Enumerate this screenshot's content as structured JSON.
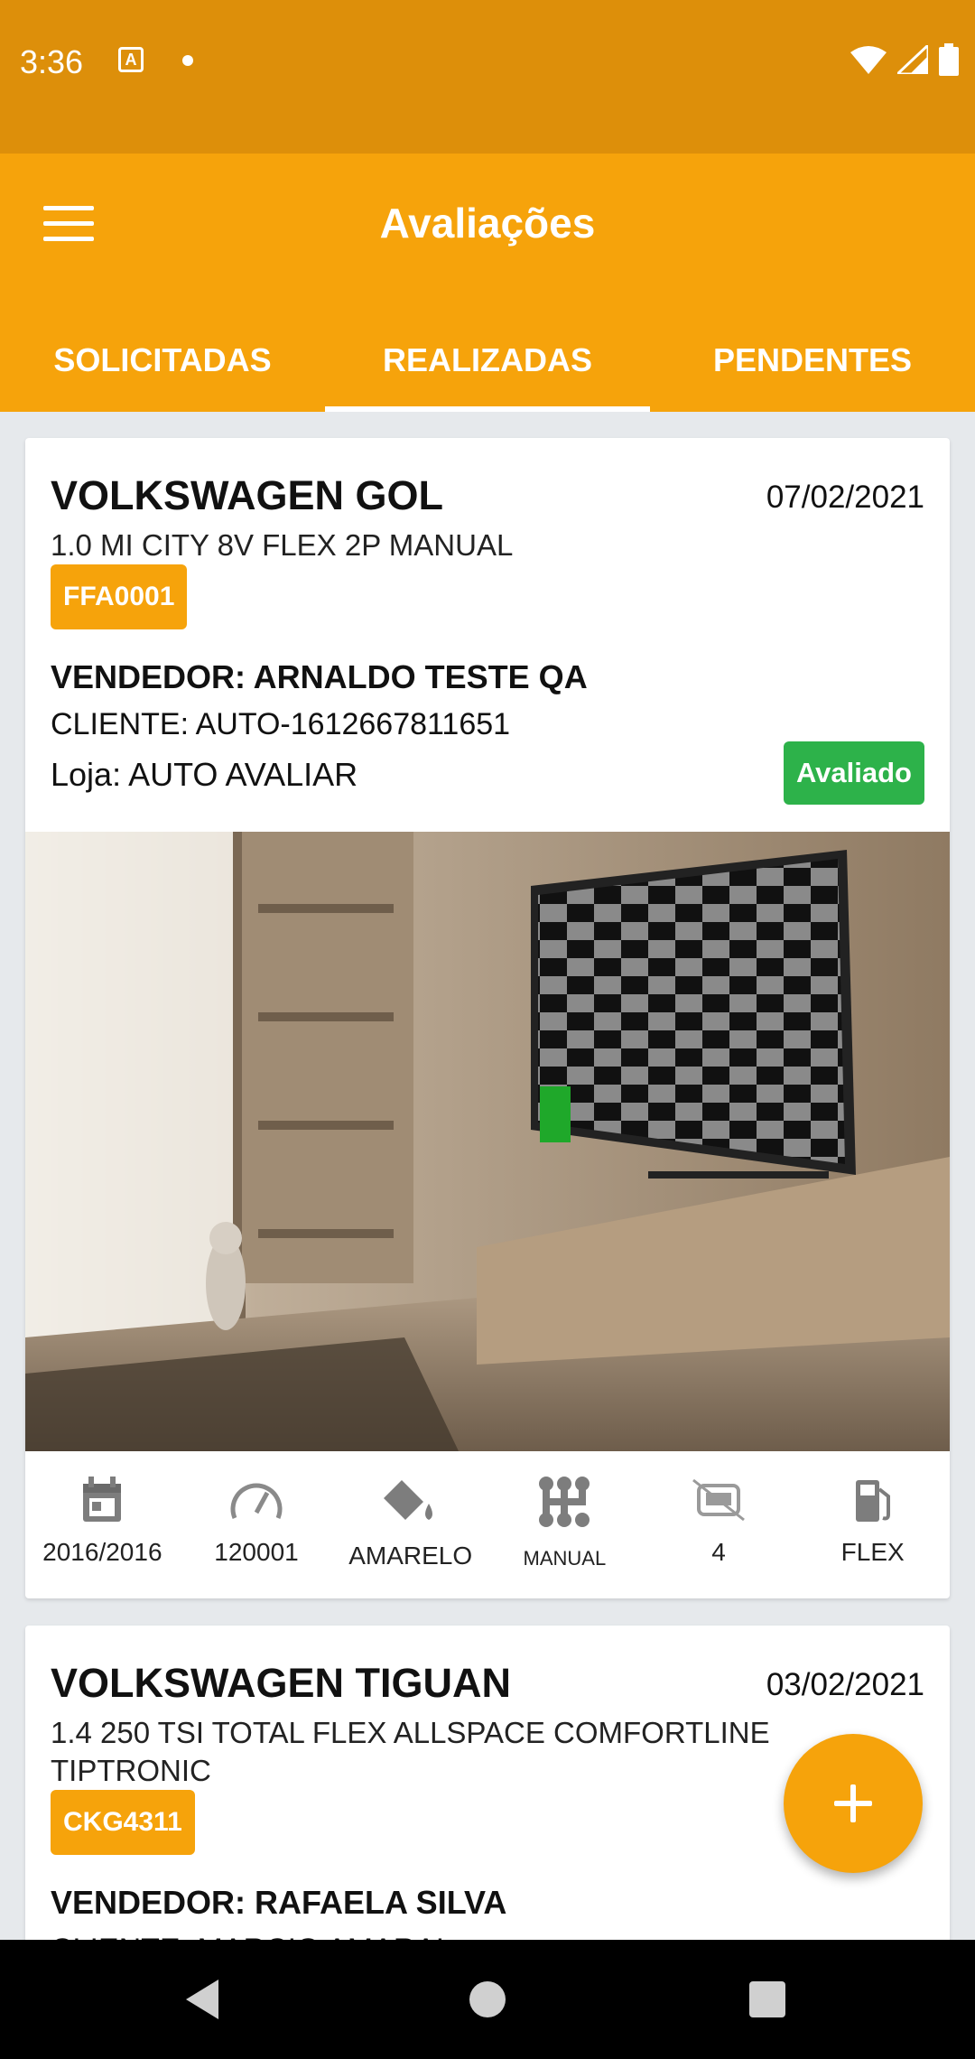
{
  "status_bar": {
    "time": "3:36",
    "notif_letter": "A"
  },
  "app_bar": {
    "title": "Avaliações",
    "tabs": [
      {
        "label": "SOLICITADAS",
        "active": false
      },
      {
        "label": "REALIZADAS",
        "active": true
      },
      {
        "label": "PENDENTES",
        "active": false
      }
    ]
  },
  "cards": [
    {
      "title": "VOLKSWAGEN GOL",
      "date": "07/02/2021",
      "version": "1.0 MI CITY 8V FLEX 2P MANUAL",
      "plate": "FFA0001",
      "seller": "VENDEDOR: ARNALDO TESTE QA",
      "client": "CLIENTE: AUTO-1612667811651",
      "store": "Loja: AUTO AVALIAR",
      "status": "Avaliado",
      "specs": {
        "year": "2016/2016",
        "mileage": "120001",
        "color": "AMARELO",
        "transmission": "MANUAL",
        "doors": "4",
        "fuel": "FLEX"
      }
    },
    {
      "title": "VOLKSWAGEN TIGUAN",
      "date": "03/02/2021",
      "version": "1.4 250 TSI TOTAL FLEX ALLSPACE COMFORTLINE TIPTRONIC",
      "plate": "CKG4311",
      "seller": "VENDEDOR: RAFAELA SILVA",
      "client": "CLIENTE: MARCIO AMARAL"
    }
  ],
  "colors": {
    "status_bar": "#dd8f0a",
    "primary": "#f6a30b",
    "success": "#2db24a"
  },
  "icons": [
    "calendar-icon",
    "speedometer-icon",
    "paint-bucket-icon",
    "gearshift-icon",
    "car-doors-icon",
    "fuel-pump-icon",
    "add-icon"
  ]
}
